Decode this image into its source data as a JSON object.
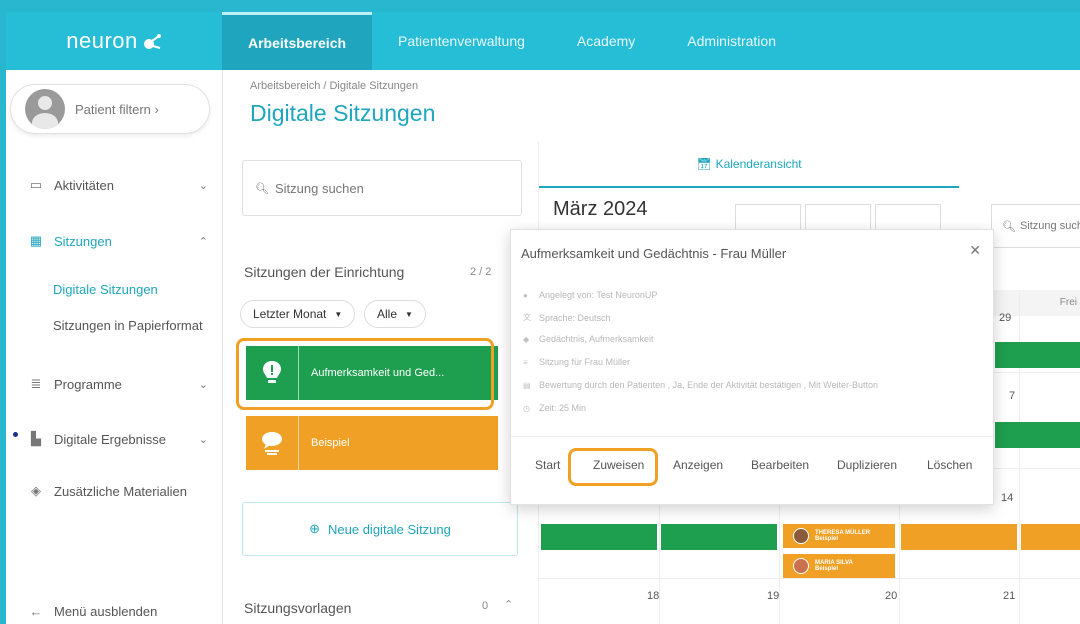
{
  "app": {
    "logo": "neuron"
  },
  "nav": {
    "tabs": [
      "Arbeitsbereich",
      "Patientenverwaltung",
      "Academy",
      "Administration"
    ]
  },
  "sidebar": {
    "patient_filter": "Patient filtern  ›",
    "items": [
      {
        "label": "Aktivitäten"
      },
      {
        "label": "Sitzungen"
      },
      {
        "label": "Programme"
      },
      {
        "label": "Digitale Ergebnisse"
      },
      {
        "label": "Zusätzliche Materialien"
      }
    ],
    "sub_items": [
      "Digitale Sitzungen",
      "Sitzungen in Papierformat"
    ],
    "hide_menu": "Menü ausblenden"
  },
  "page": {
    "breadcrumb": "Arbeitsbereich  /  Digitale Sitzungen",
    "title": "Digitale Sitzungen"
  },
  "left": {
    "search_placeholder": "Sitzung suchen",
    "section1_title": "Sitzungen der Einrichtung",
    "section1_count": "2 / 2",
    "filters": [
      "Letzter Monat",
      "Alle"
    ],
    "sessions": [
      {
        "label": "Aufmerksamkeit und Ged...",
        "color": "#1e9e4f"
      },
      {
        "label": "Beispiel",
        "color": "#f0a024"
      }
    ],
    "new_button": "Neue digitale Sitzung",
    "section2_title": "Sitzungsvorlagen",
    "section2_count": "0"
  },
  "calendar": {
    "tab": "Kalenderansicht",
    "month": "März 2024",
    "search_placeholder": "Sitzung such",
    "header_day": "Frei",
    "days": [
      "7",
      "14",
      "18",
      "19",
      "20",
      "21",
      "29"
    ],
    "events": [
      {
        "name": "THERESA MÜLLER",
        "sub": "Beispiel"
      },
      {
        "name": "MARIA SILVA",
        "sub": "Beispiel"
      }
    ]
  },
  "popup": {
    "title": "Aufmerksamkeit und Gedächtnis - Frau Müller",
    "lines": [
      "Angelegt von: Test NeuronUP",
      "Sprache: Deutsch",
      "Gedächtnis, Aufmerksamkeit",
      "Sitzung für Frau Müller",
      "Bewertung durch den Patienten , Ja, Ende der Aktivität bestätigen , Mit Weiter-Button",
      "Zeit: 25 Min"
    ],
    "actions": [
      "Start",
      "Zuweisen",
      "Anzeigen",
      "Bearbeiten",
      "Duplizieren",
      "Löschen"
    ]
  }
}
